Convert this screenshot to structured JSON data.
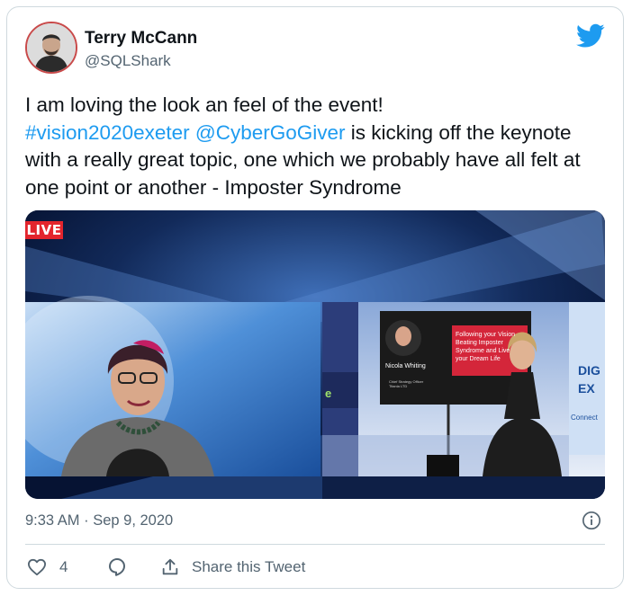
{
  "author": {
    "name": "Terry McCann",
    "handle": "@SQLShark"
  },
  "tweet": {
    "line1": "I am loving the look an feel of the event!",
    "hashtag": "#vision2020exeter",
    "mention": "@CyberGoGiver",
    "rest": " is kicking off the keynote with a really great topic, one which we probably have all felt at one point or another - Imposter Syndrome"
  },
  "media": {
    "live_badge": "LIVE",
    "slide_line1": "Following your Vision",
    "slide_line2": "Beating Imposter",
    "slide_line3": "Syndrome and Live",
    "slide_line4": "your Dream Life",
    "speaker_name": "Nicola Whiting",
    "speaker_title_1": "Chief Strategy Officer",
    "speaker_title_2": "Titania LTD",
    "sign_line1": "DIG",
    "sign_line2": "EX",
    "sign_line3": "Connect",
    "stage_letter": "e"
  },
  "meta": {
    "time": "9:33 AM",
    "separator": " · ",
    "date": "Sep 9, 2020"
  },
  "actions": {
    "like_count": "4",
    "share_label": "Share this Tweet"
  },
  "colors": {
    "link": "#1d9bf0",
    "secondary_text": "#536471",
    "live_red": "#e3252d",
    "border": "#cfd9de"
  },
  "icons": [
    "twitter-bird-icon",
    "info-icon",
    "heart-icon",
    "reply-icon",
    "share-icon"
  ]
}
